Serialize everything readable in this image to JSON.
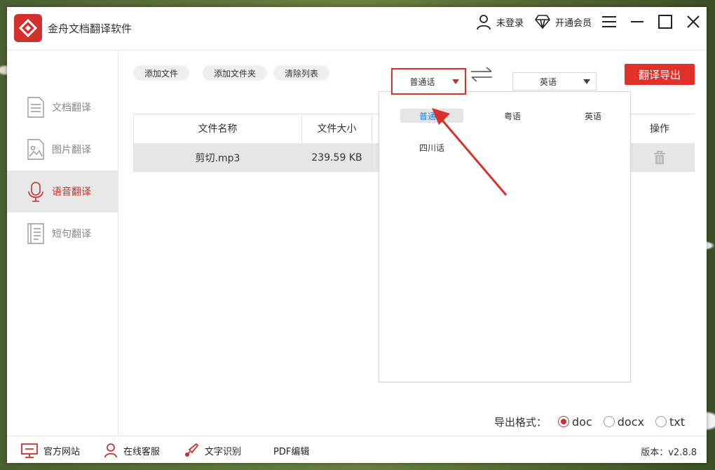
{
  "app": {
    "title": "金舟文档翻译软件"
  },
  "header": {
    "login": "未登录",
    "vip": "开通会员"
  },
  "sidebar": {
    "items": [
      {
        "label": "文档翻译",
        "icon": "document-icon"
      },
      {
        "label": "图片翻译",
        "icon": "image-icon"
      },
      {
        "label": "语音翻译",
        "icon": "microphone-icon",
        "active": true
      },
      {
        "label": "短句翻译",
        "icon": "text-icon"
      }
    ]
  },
  "toolbar": {
    "add_file": "添加文件",
    "add_folder": "添加文件夹",
    "clear_list": "清除列表",
    "translate_export": "翻译导出"
  },
  "language": {
    "source": "普通话",
    "target": "英语",
    "options": [
      "普通话",
      "粤语",
      "英语",
      "四川话"
    ]
  },
  "table": {
    "headers": [
      "文件名称",
      "文件大小",
      "操作"
    ],
    "rows": [
      {
        "name": "剪切.mp3",
        "size": "239.59 KB"
      }
    ]
  },
  "export": {
    "label": "导出格式：",
    "formats": [
      "doc",
      "docx",
      "txt"
    ],
    "selected": "doc"
  },
  "footer": {
    "website": "官方网站",
    "support": "在线客服",
    "ocr": "文字识别",
    "pdf": "PDF编辑",
    "version": "版本：v2.8.8"
  },
  "colors": {
    "accent": "#e2302b",
    "selected_text": "#1e7fd6",
    "annotation": "#d9302c"
  }
}
